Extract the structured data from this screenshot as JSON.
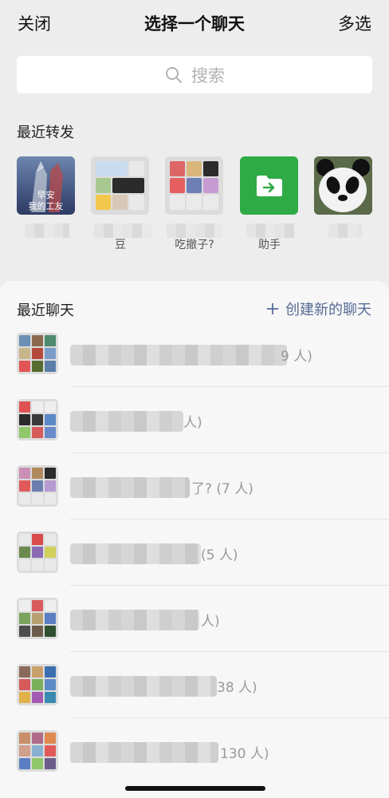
{
  "header": {
    "close_label": "关闭",
    "title": "选择一个聊天",
    "multi_select_label": "多选"
  },
  "search": {
    "placeholder": "搜索",
    "icon": "search-icon"
  },
  "recent_forward": {
    "title": "最近转发",
    "items": [
      {
        "name": "",
        "avatar_text": [
          "早安",
          "我的工友"
        ],
        "avatar": "ultraman-photo"
      },
      {
        "name": "豆",
        "avatar": "group-grid"
      },
      {
        "name": "吃撤子?",
        "avatar": "group-grid"
      },
      {
        "name": "助手",
        "avatar": "folder-transfer-icon",
        "color": "#2fab46"
      },
      {
        "name": "",
        "avatar": "panda-photo"
      }
    ]
  },
  "recent_chats": {
    "title": "最近聊天",
    "create_label": "创建新的聊天",
    "create_icon": "plus-icon",
    "rows": [
      {
        "count_text": "9 人)"
      },
      {
        "count_text": "人)"
      },
      {
        "count_text": "了? (7 人)"
      },
      {
        "count_text": "(5 人)"
      },
      {
        "count_text": "人)"
      },
      {
        "count_text": "38 人)"
      },
      {
        "count_text": "130 人)"
      }
    ]
  },
  "colors": {
    "accent_link": "#576b95",
    "file_helper_green": "#2fab46",
    "background": "#ededed"
  }
}
